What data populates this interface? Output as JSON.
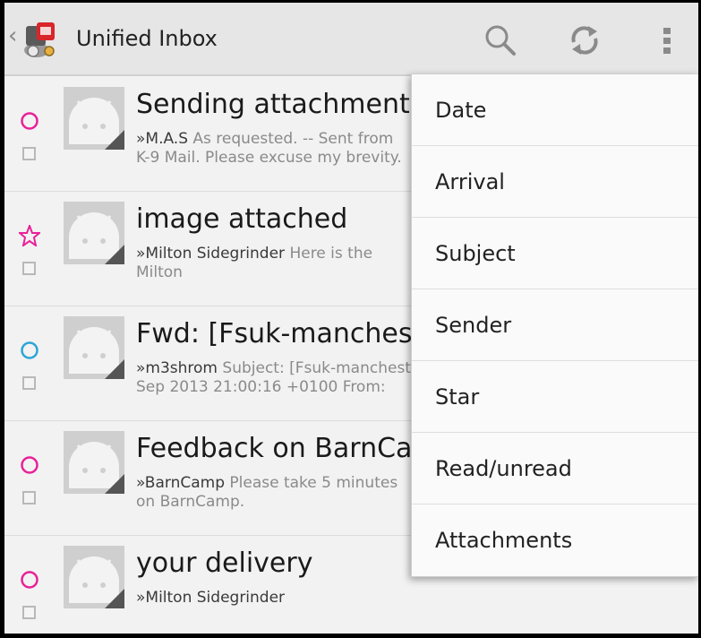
{
  "actionbar": {
    "title": "Unified Inbox",
    "icons": [
      "app-icon",
      "search-icon",
      "refresh-icon",
      "overflow-menu-icon"
    ]
  },
  "messages": [
    {
      "subject": "Sending attachment",
      "sender": "»M.A.S",
      "preview_line1": " As requested. -- Sent from",
      "preview_line2": "K-9 Mail. Please excuse my brevity.",
      "status": "unread",
      "status_color": "#e8219a"
    },
    {
      "subject": "image attached",
      "sender": "»Milton Sidegrinder",
      "preview_line1": " Here is the",
      "preview_line2": "Milton",
      "status": "starred",
      "status_color": "#e8219a"
    },
    {
      "subject": "Fwd: [Fsuk-manchester]",
      "sender": "»m3shrom",
      "preview_line1": " Subject: [Fsuk-manchester]",
      "preview_line2": "Sep 2013 21:00:16 +0100 From:",
      "status": "unread",
      "status_color": "#2aa6d6"
    },
    {
      "subject": "Feedback on BarnCamp",
      "sender": "»BarnCamp",
      "preview_line1": " Please take 5 minutes",
      "preview_line2": "on BarnCamp.",
      "status": "unread",
      "status_color": "#e8219a"
    },
    {
      "subject": "your delivery",
      "sender": "»Milton Sidegrinder",
      "preview_line1": "",
      "preview_line2": "",
      "status": "unread",
      "status_color": "#e8219a"
    }
  ],
  "sort_menu": {
    "items": [
      "Date",
      "Arrival",
      "Subject",
      "Sender",
      "Star",
      "Read/unread",
      "Attachments"
    ]
  }
}
